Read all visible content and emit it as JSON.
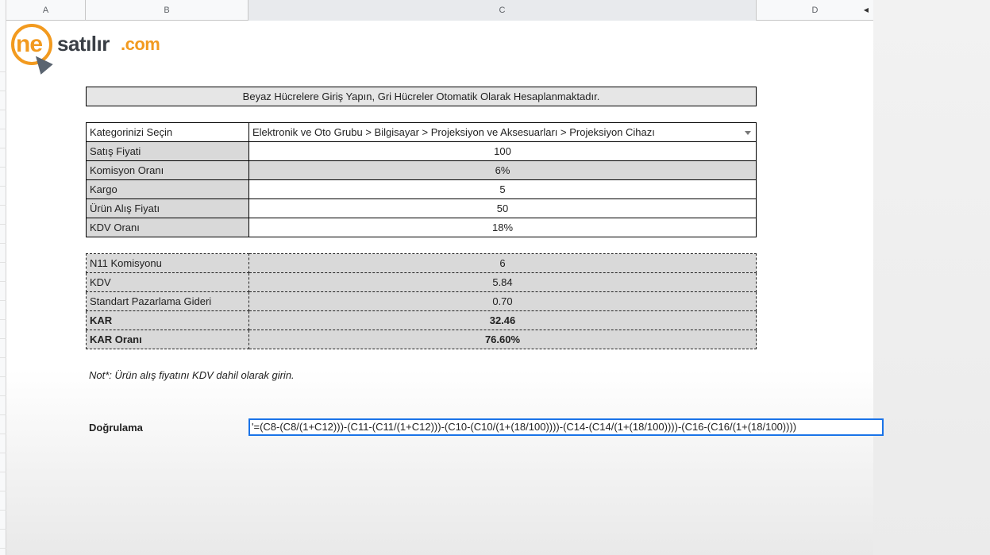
{
  "columns": [
    "A",
    "B",
    "C",
    "D"
  ],
  "logo": {
    "prefix": "ne",
    "name": "satılır",
    "suffix": ".com"
  },
  "banner": "Beyaz Hücrelere Giriş Yapın, Gri Hücreler Otomatik Olarak Hesaplanmaktadır.",
  "inputs": {
    "category": {
      "label": "Kategorinizi Seçin",
      "value": "Elektronik ve Oto Grubu > Bilgisayar > Projeksiyon ve Aksesuarları > Projeksiyon Cihazı"
    },
    "rows": [
      {
        "label": "Satış Fiyati",
        "value": "100"
      },
      {
        "label": "Komisyon Oranı",
        "value": "6%"
      },
      {
        "label": "Kargo",
        "value": "5"
      },
      {
        "label": "Ürün Alış Fiyatı",
        "value": "50"
      },
      {
        "label": "KDV Oranı",
        "value": "18%"
      }
    ]
  },
  "outputs": [
    {
      "label": "N11 Komisyonu",
      "value": "6"
    },
    {
      "label": "KDV",
      "value": "5.84"
    },
    {
      "label": "Standart Pazarlama Gideri",
      "value": "0.70"
    },
    {
      "label": "KAR",
      "value": "32.46"
    },
    {
      "label": "KAR Oranı",
      "value": "76.60%"
    }
  ],
  "note": "Not*: Ürün alış fiyatını KDV dahil olarak girin.",
  "verify": {
    "label": "Doğrulama",
    "formula": "'=(C8-(C8/(1+C12)))-(C11-(C11/(1+C12)))-(C10-(C10/(1+(18/100))))-(C14-(C14/(1+(18/100))))-(C16-(C16/(1+(18/100))))"
  },
  "colors": {
    "accent": "#f29a1f",
    "selection": "#1a73e8",
    "gray_cell": "#d9d9d9"
  },
  "icons": [
    "dropdown-arrow-icon",
    "scroll-left-arrow-icon",
    "cursor-pointer-icon"
  ]
}
